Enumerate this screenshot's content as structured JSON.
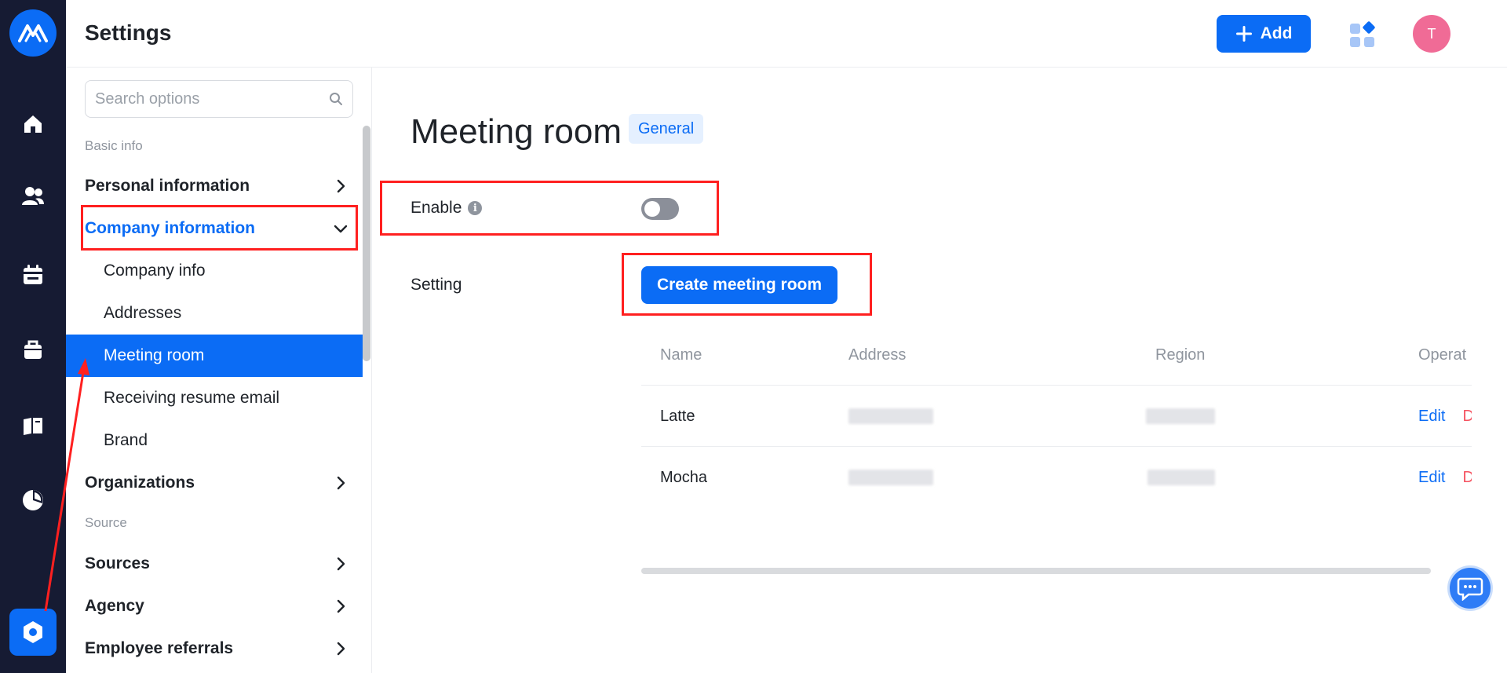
{
  "header": {
    "title": "Settings",
    "add_label": "Add",
    "avatar_initial": "T"
  },
  "search": {
    "placeholder": "Search options"
  },
  "menu": {
    "section_basic": "Basic info",
    "section_source": "Source",
    "items": {
      "personal": "Personal information",
      "company": "Company information",
      "organizations": "Organizations",
      "sources": "Sources",
      "agency": "Agency",
      "referrals": "Employee referrals"
    },
    "company_sub": {
      "company_info": "Company info",
      "addresses": "Addresses",
      "meeting_room": "Meeting room",
      "resume_email": "Receiving resume email",
      "brand": "Brand"
    }
  },
  "main": {
    "title": "Meeting room",
    "badge": "General",
    "enable_label": "Enable",
    "enable_state": "off",
    "setting_label": "Setting",
    "create_button": "Create meeting room",
    "table": {
      "headers": {
        "name": "Name",
        "address": "Address",
        "region": "Region",
        "operation": "Operat"
      },
      "rows": [
        {
          "name": "Latte",
          "edit": "Edit",
          "delete": "Del"
        },
        {
          "name": "Mocha",
          "edit": "Edit",
          "delete": "Del"
        }
      ]
    }
  },
  "colors": {
    "primary": "#0b6cf5",
    "rail": "#161b33",
    "annotation": "#ff2020",
    "delete": "#f5515f",
    "avatar": "#f06b96"
  },
  "icons": [
    "logo-icon",
    "home-icon",
    "people-icon",
    "calendar-icon",
    "briefcase-icon",
    "book-icon",
    "pie-chart-icon",
    "settings-icon",
    "plus-icon",
    "apps-icon",
    "search-icon",
    "chevron-right-icon",
    "chevron-down-icon",
    "info-icon",
    "chat-icon"
  ]
}
